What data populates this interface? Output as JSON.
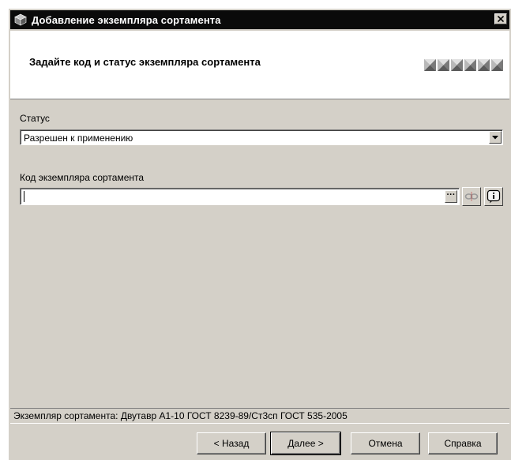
{
  "window": {
    "title": "Добавление экземпляра сортамента",
    "close_icon": "close-icon"
  },
  "header": {
    "heading": "Задайте код и статус экземпляра сортамента",
    "steps_icon": "wizard-step-icon",
    "step_count": 6
  },
  "status_field": {
    "label": "Статус",
    "value": "Разрешен к применению"
  },
  "code_field": {
    "label": "Код экземпляра сортамента",
    "value": "",
    "browse_label": "···"
  },
  "status_bar": {
    "text": "Экземпляр сортамента: Двутавр А1-10 ГОСТ 8239-89/Ст3сп ГОСТ 535-2005"
  },
  "buttons": {
    "back": "< Назад",
    "next": "Далее >",
    "cancel": "Отмена",
    "help": "Справка"
  },
  "colors": {
    "dialog_bg": "#d4d0c8",
    "titlebar_bg": "#0a0a0a"
  }
}
